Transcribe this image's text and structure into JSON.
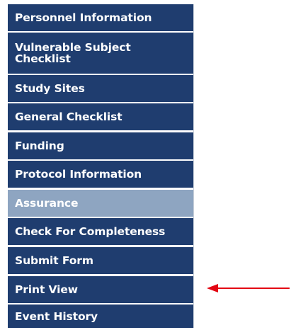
{
  "sidebar": {
    "items": [
      {
        "label": "Personnel Information",
        "active": false
      },
      {
        "label": "Vulnerable Subject Checklist",
        "active": false
      },
      {
        "label": "Study Sites",
        "active": false
      },
      {
        "label": "General Checklist",
        "active": false
      },
      {
        "label": "Funding",
        "active": false
      },
      {
        "label": "Protocol Information",
        "active": false
      },
      {
        "label": "Assurance",
        "active": true
      },
      {
        "label": "Check For Completeness",
        "active": false
      },
      {
        "label": "Submit Form",
        "active": false
      },
      {
        "label": "Print View",
        "active": false
      },
      {
        "label": "Event History",
        "active": false
      }
    ]
  },
  "colors": {
    "nav_background": "#1f3d6f",
    "nav_active": "#8ea5c1",
    "nav_text": "#ffffff",
    "arrow": "#e30613"
  }
}
